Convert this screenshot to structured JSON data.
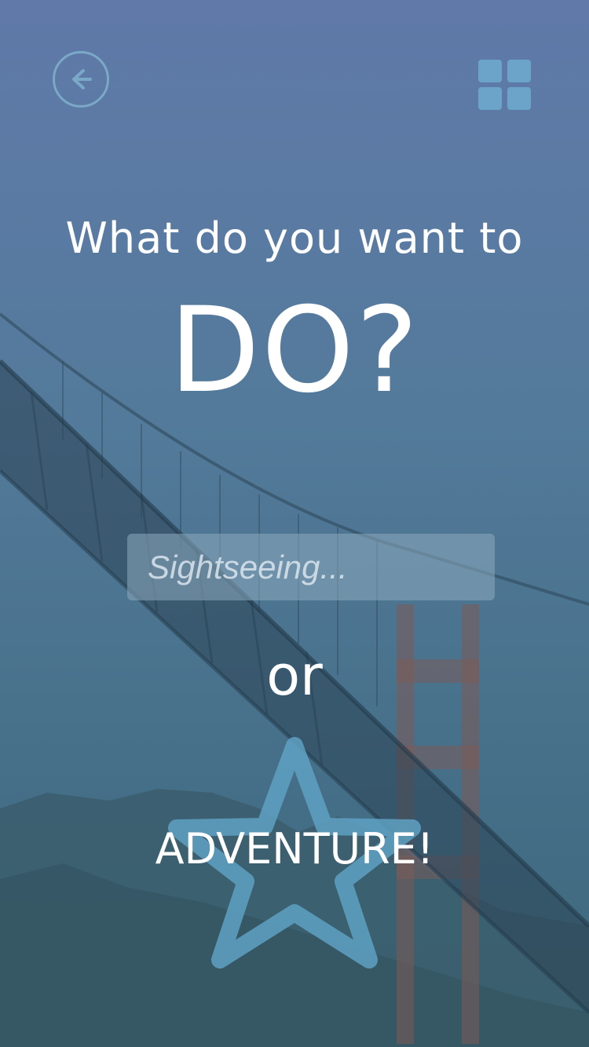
{
  "header": {
    "back_icon": "back-arrow-icon",
    "menu_icon": "grid-icon"
  },
  "question": {
    "line1": "What do you want to",
    "line2": "DO?"
  },
  "search": {
    "placeholder": "Sightseeing...",
    "value": ""
  },
  "separator": "or",
  "adventure": {
    "label": "ADVENTURE!",
    "icon": "star-icon"
  },
  "colors": {
    "accent": "#6ba4c8",
    "text": "#ffffff"
  }
}
